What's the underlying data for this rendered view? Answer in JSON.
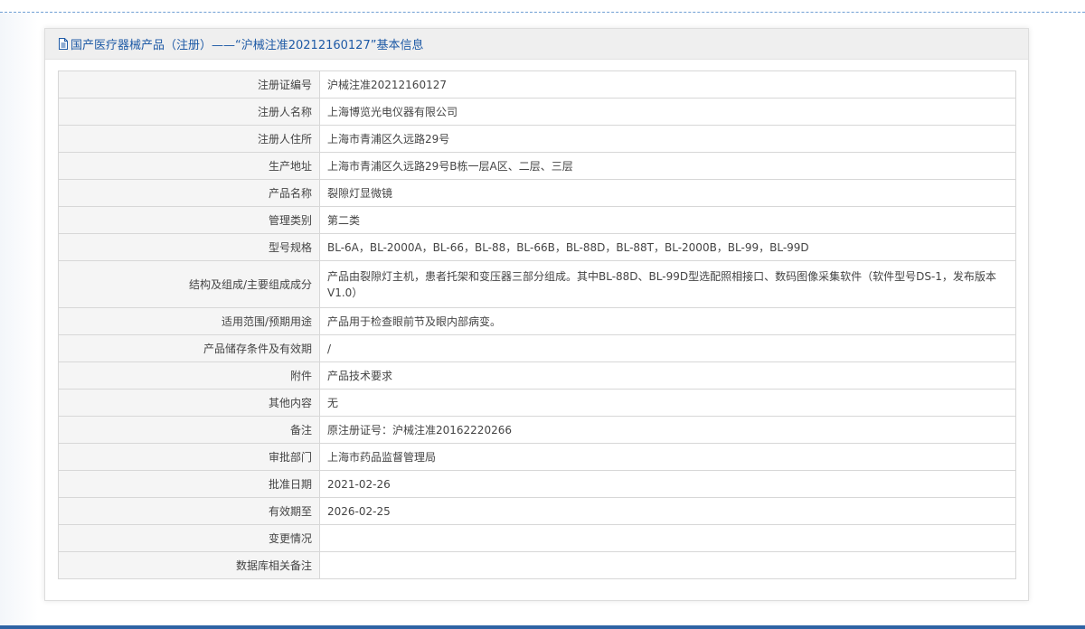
{
  "header": {
    "title": "国产医疗器械产品（注册）——“沪械注准20212160127”基本信息"
  },
  "rows": [
    {
      "label": "注册证编号",
      "value": "沪械注准20212160127"
    },
    {
      "label": "注册人名称",
      "value": "上海博览光电仪器有限公司"
    },
    {
      "label": "注册人住所",
      "value": "上海市青浦区久远路29号"
    },
    {
      "label": "生产地址",
      "value": "上海市青浦区久远路29号B栋一层A区、二层、三层"
    },
    {
      "label": "产品名称",
      "value": "裂隙灯显微镜"
    },
    {
      "label": "管理类别",
      "value": "第二类"
    },
    {
      "label": "型号规格",
      "value": "BL-6A，BL-2000A，BL-66，BL-88，BL-66B，BL-88D，BL-88T，BL-2000B，BL-99，BL-99D"
    },
    {
      "label": "结构及组成/主要组成成分",
      "value": "产品由裂隙灯主机，患者托架和变压器三部分组成。其中BL-88D、BL-99D型选配照相接口、数码图像采集软件（软件型号DS-1，发布版本V1.0）"
    },
    {
      "label": "适用范围/预期用途",
      "value": "产品用于检查眼前节及眼内部病变。"
    },
    {
      "label": "产品储存条件及有效期",
      "value": "/"
    },
    {
      "label": "附件",
      "value": "产品技术要求"
    },
    {
      "label": "其他内容",
      "value": "无"
    },
    {
      "label": "备注",
      "value": "原注册证号：沪械注准20162220266"
    },
    {
      "label": "审批部门",
      "value": "上海市药品监督管理局"
    },
    {
      "label": "批准日期",
      "value": "2021-02-26"
    },
    {
      "label": "有效期至",
      "value": "2026-02-25"
    },
    {
      "label": "变更情况",
      "value": ""
    },
    {
      "label": "数据库相关备注",
      "value": ""
    }
  ]
}
